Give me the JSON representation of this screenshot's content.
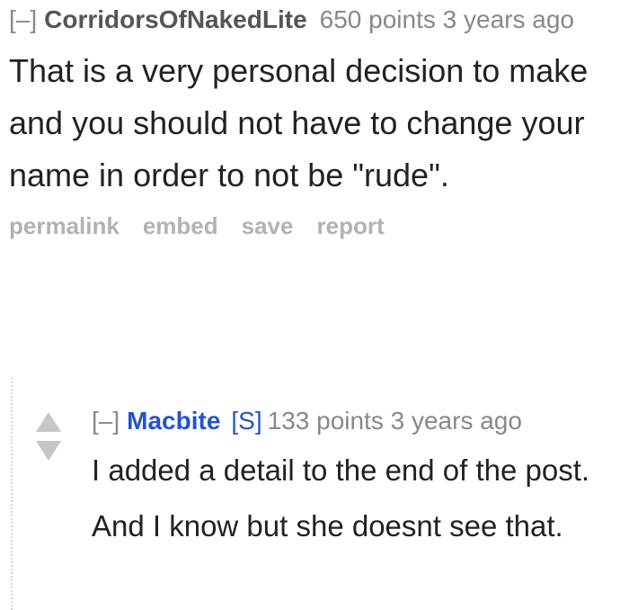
{
  "parent_comment": {
    "collapse_label": "[–]",
    "author": "CorridorsOfNakedLite",
    "points": "650 points",
    "time": "3 years ago",
    "body": "That is a very personal decision to make and you should not have to change your name in order to not be \"rude\".",
    "buttons": [
      "permalink",
      "embed",
      "save",
      "report"
    ]
  },
  "child_comment": {
    "collapse_label": "[–]",
    "author": "Macbite",
    "submitter_flag": "[S]",
    "points": "133 points",
    "time": "3 years ago",
    "body": "I added a detail to the end of the post. And I know but she doesnt see that.",
    "vote_icons": [
      "upvote-arrow-icon",
      "downvote-arrow-icon"
    ]
  },
  "colors": {
    "author_main": "#555555",
    "author_child": "#2255cc",
    "meta": "#888888",
    "buttons": "#b2b2b2",
    "vote_arrows": "#c6c6c6"
  }
}
